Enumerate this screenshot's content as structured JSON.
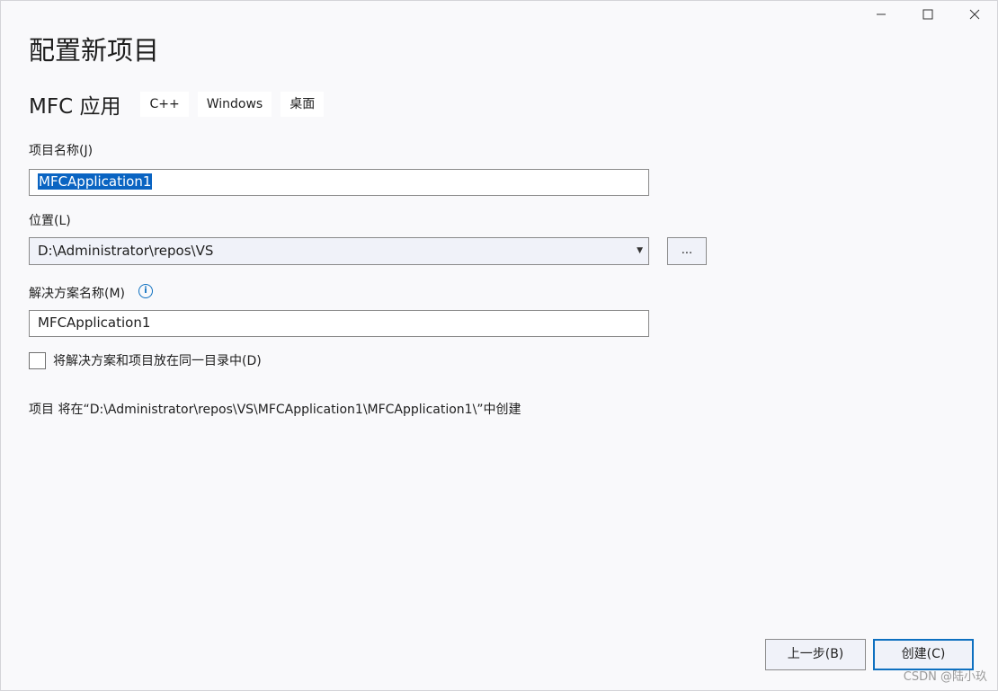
{
  "window": {
    "minimize_icon": "minimize-icon",
    "maximize_icon": "maximize-icon",
    "close_icon": "close-icon"
  },
  "title": "配置新项目",
  "template": {
    "name": "MFC 应用",
    "tags": [
      "C++",
      "Windows",
      "桌面"
    ]
  },
  "project_name": {
    "label": "项目名称(J)",
    "value": "MFCApplication1"
  },
  "location": {
    "label": "位置(L)",
    "value": "D:\\Administrator\\repos\\VS",
    "browse_label": "..."
  },
  "solution_name": {
    "label": "解决方案名称(M)",
    "value": "MFCApplication1",
    "info_icon": "info-icon"
  },
  "same_directory": {
    "label": "将解决方案和项目放在同一目录中(D)",
    "checked": false
  },
  "path_info": "项目 将在“D:\\Administrator\\repos\\VS\\MFCApplication1\\MFCApplication1\\”中创建",
  "buttons": {
    "back": "上一步(B)",
    "create": "创建(C)"
  },
  "watermark": "CSDN @陆小玖",
  "colors": {
    "accent": "#0e70c0",
    "selection": "#0a64c2",
    "background": "#f9f9fb"
  }
}
